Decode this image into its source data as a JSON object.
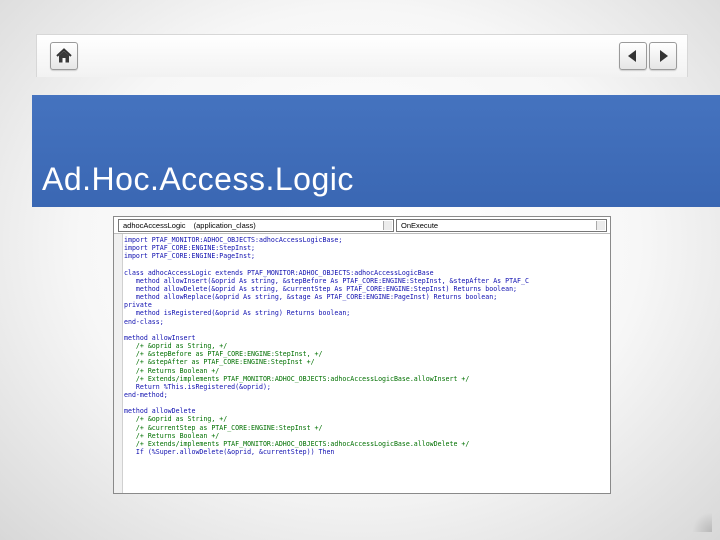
{
  "slide": {
    "title": "Ad.Hoc.Access.Logic"
  },
  "nav": {
    "home_icon": "home-icon",
    "prev_icon": "triangle-left-icon",
    "next_icon": "triangle-right-icon"
  },
  "colors": {
    "title_band": "#4270bd",
    "title_text": "#ffffff",
    "keyword": "#1010b0",
    "comment": "#007000"
  },
  "editor": {
    "object_select": "adhocAccessLogic",
    "proc_select": "(application_class)",
    "event_select": "OnExecute",
    "lines": [
      "import PTAF_MONITOR:ADHOC_OBJECTS:adhocAccessLogicBase;",
      "import PTAF_CORE:ENGINE:StepInst;",
      "import PTAF_CORE:ENGINE:PageInst;",
      "",
      "class adhocAccessLogic extends PTAF_MONITOR:ADHOC_OBJECTS:adhocAccessLogicBase",
      "   method allowInsert(&oprid As string, &stepBefore As PTAF_CORE:ENGINE:StepInst, &stepAfter As PTAF_C",
      "   method allowDelete(&oprid As string, &currentStep As PTAF_CORE:ENGINE:StepInst) Returns boolean;",
      "   method allowReplace(&oprid As string, &stage As PTAF_CORE:ENGINE:PageInst) Returns boolean;",
      "private",
      "   method isRegistered(&oprid As string) Returns boolean;",
      "end-class;",
      "",
      "method allowInsert",
      "   /+ &oprid as String, +/",
      "   /+ &stepBefore as PTAF_CORE:ENGINE:StepInst, +/",
      "   /+ &stepAfter as PTAF_CORE:ENGINE:StepInst +/",
      "   /+ Returns Boolean +/",
      "   /+ Extends/implements PTAF_MONITOR:ADHOC_OBJECTS:adhocAccessLogicBase.allowInsert +/",
      "   Return %This.isRegistered(&oprid);",
      "end-method;",
      "",
      "method allowDelete",
      "   /+ &oprid as String, +/",
      "   /+ &currentStep as PTAF_CORE:ENGINE:StepInst +/",
      "   /+ Returns Boolean +/",
      "   /+ Extends/implements PTAF_MONITOR:ADHOC_OBJECTS:adhocAccessLogicBase.allowDelete +/",
      "   If (%Super.allowDelete(&oprid, &currentStep)) Then"
    ]
  }
}
